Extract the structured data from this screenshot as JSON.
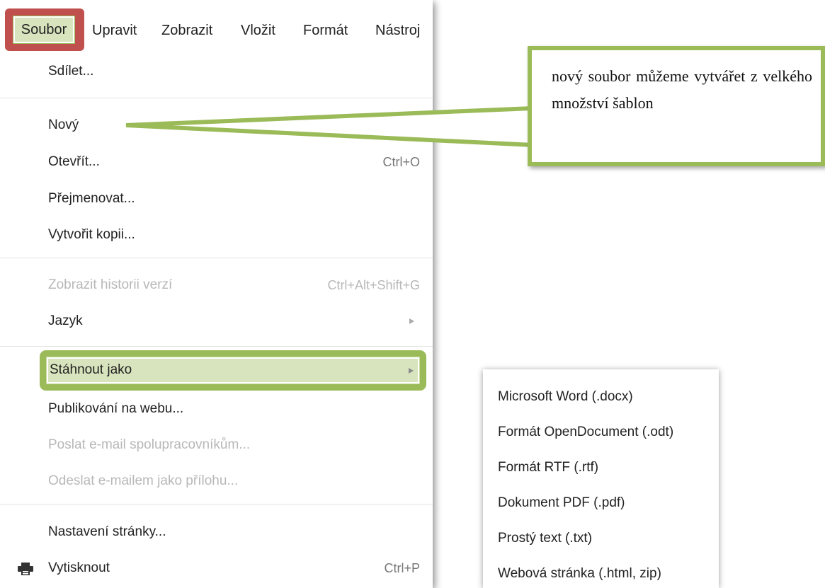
{
  "menubar": {
    "items": [
      "Soubor",
      "Upravit",
      "Zobrazit",
      "Vložit",
      "Formát",
      "Nástroj"
    ]
  },
  "menu": {
    "share": "Sdílet...",
    "new": "Nový",
    "open": "Otevřít...",
    "open_shortcut": "Ctrl+O",
    "rename": "Přejmenovat...",
    "copy": "Vytvořit kopii...",
    "history": "Zobrazit historii verzí",
    "history_shortcut": "Ctrl+Alt+Shift+G",
    "language": "Jazyk",
    "download": "Stáhnout jako",
    "publish": "Publikování na webu...",
    "email_collab": "Poslat e-mail spolupracovníkům...",
    "email_attach": "Odeslat e-mailem jako přílohu...",
    "page_setup": "Nastavení stránky...",
    "print": "Vytisknout",
    "print_shortcut": "Ctrl+P"
  },
  "callout": {
    "text": "nový soubor můžeme vytvářet z velkého množství šablon"
  },
  "submenu": {
    "items": [
      "Microsoft Word (.docx)",
      "Formát OpenDocument (.odt)",
      "Formát RTF (.rtf)",
      "Dokument PDF (.pdf)",
      "Prostý text (.txt)",
      "Webová stránka (.html, zip)"
    ]
  },
  "colors": {
    "highlight_red": "#c0504d",
    "highlight_green": "#9bbb59",
    "highlight_fill": "#d7e4bd",
    "disabled_text": "#b8b8b8"
  },
  "icons": [
    "printer-icon",
    "submenu-arrow-icon"
  ]
}
